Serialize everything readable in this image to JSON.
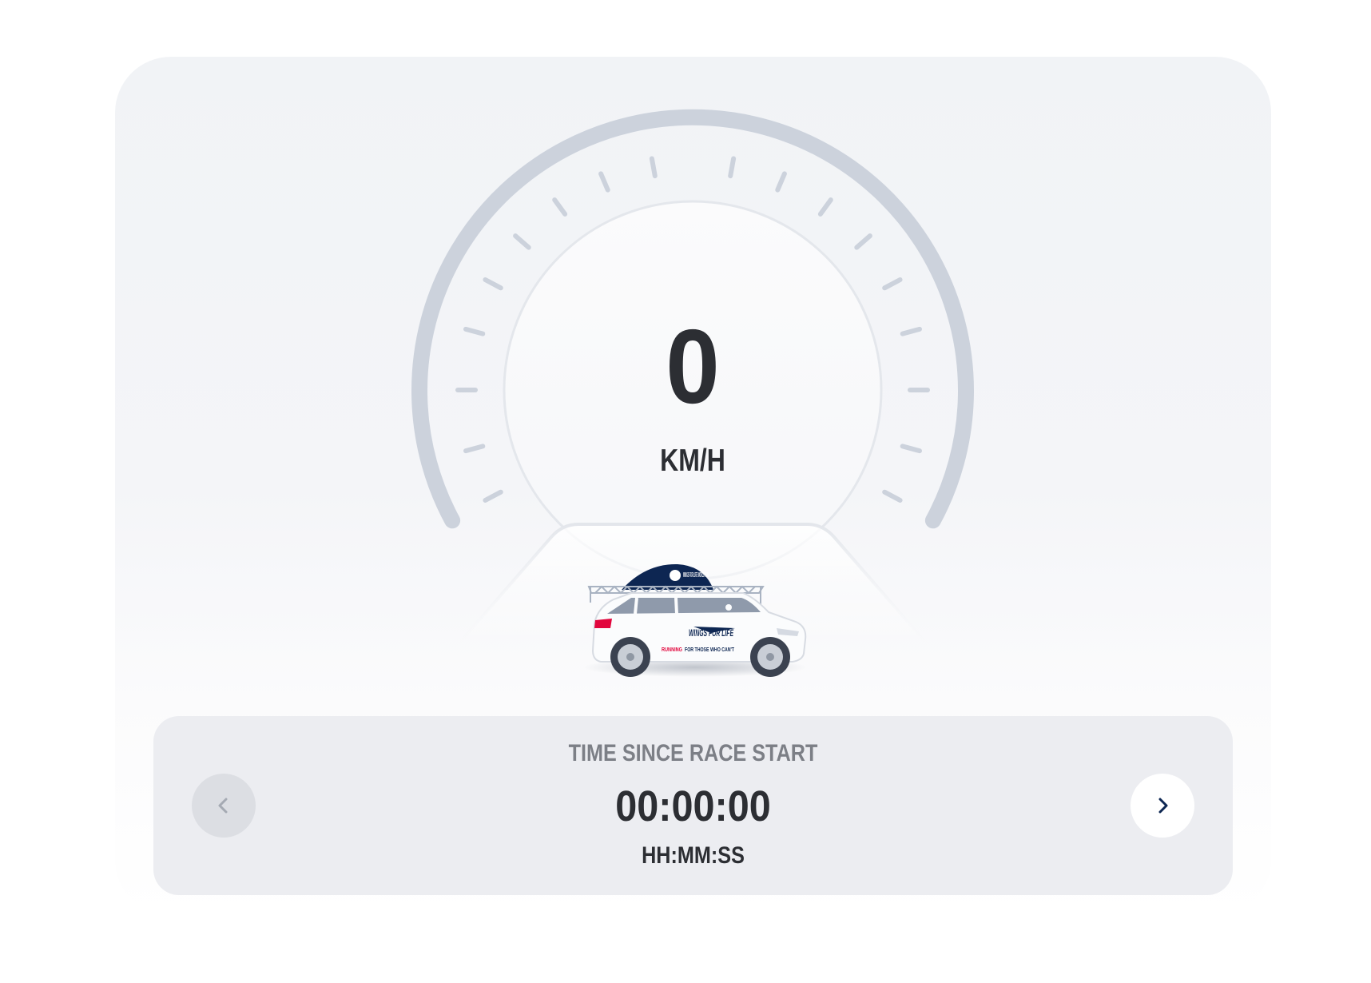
{
  "speedometer": {
    "speed": "0",
    "unit": "KM/H"
  },
  "catcher_car": {
    "roof_logo": "WINGS FOR LIFE WORLD RUN",
    "door_logo": "WINGS FOR LIFE",
    "slogan_highlight": "RUNNING",
    "slogan_rest": "FOR THOSE WHO CAN'T"
  },
  "race_info": {
    "caption": "TIME SINCE RACE START",
    "value": "00:00:00",
    "format": "HH:MM:SS",
    "prev_icon": "chevron-left-icon",
    "next_icon": "chevron-right-icon"
  },
  "colors": {
    "card_background": "#f1f3f6",
    "gauge_track": "#ccd2dc",
    "text_dark": "#2c2e33",
    "text_muted": "#7c7f86",
    "brand_navy": "#0d2652",
    "brand_red": "#e2063d"
  }
}
